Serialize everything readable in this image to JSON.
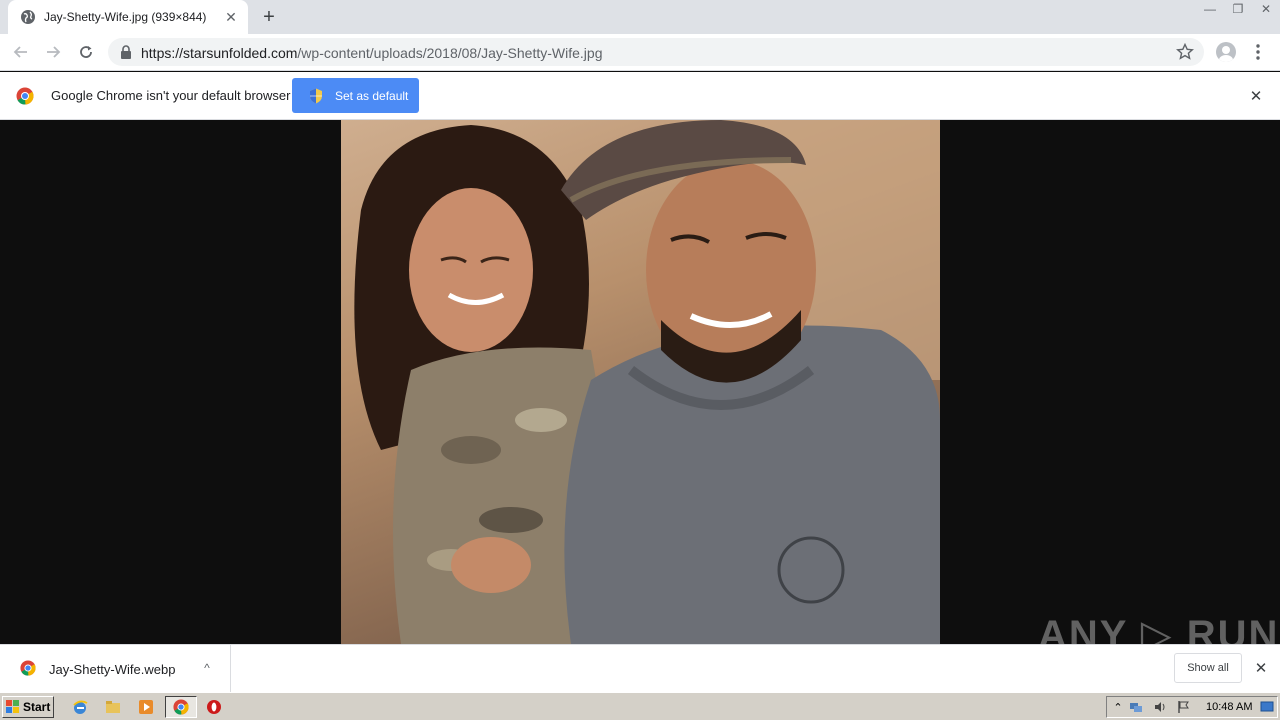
{
  "tab": {
    "title": "Jay-Shetty-Wife.jpg (939×844)",
    "close_label": "✕",
    "new_tab_label": "+"
  },
  "window_controls": {
    "minimize": "—",
    "restore": "❐",
    "close": "✕"
  },
  "address_bar": {
    "url_host": "https://starsunfolded.com",
    "url_path": "/wp-content/uploads/2018/08/Jay-Shetty-Wife.jpg"
  },
  "infobar": {
    "message": "Google Chrome isn't your default browser",
    "button_label": "Set as default",
    "close_label": "✕"
  },
  "watermark": {
    "text": "ANY ▷ RUN"
  },
  "download_bar": {
    "filename": "Jay-Shetty-Wife.webp",
    "caret": "^",
    "show_all_label": "Show all",
    "close_label": "✕"
  },
  "taskbar": {
    "start_label": "Start",
    "clock": "10:48 AM"
  },
  "colors": {
    "tabstrip": "#dee1e6",
    "accent_button": "#4c8bf5",
    "viewer_bg": "#0e0e0e",
    "taskbar": "#d4d0c8"
  }
}
